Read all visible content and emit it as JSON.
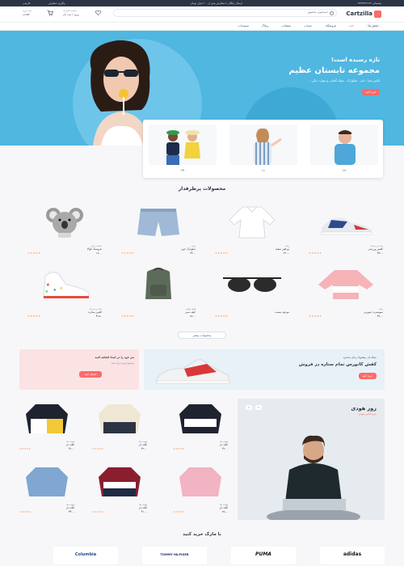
{
  "topbar": {
    "phone": "پشتیبانی ۰۹۳۳۳۴۳۲۱۲۳",
    "shipping": "ارسال رایگان با سفارش بیش از ۲۰۰ هزار تومان",
    "order_tracking": "پیگیری سفارش",
    "lang": "فارسی"
  },
  "header": {
    "logo": "Cartzilla",
    "search_placeholder": "جستجوی محصول",
    "account_line1": "حساب کاربری",
    "account_line2": "ورود / ثبت نام",
    "cart_label": "سبد خرید",
    "cart_total": "۶۵۷ت"
  },
  "nav": {
    "categories": "بخش ها",
    "items": [
      "خانه",
      "فروشگاه",
      "حساب",
      "صفحات",
      "وبلاگ",
      "مستندات"
    ]
  },
  "hero": {
    "eyebrow": "تازه رسیده است!",
    "title": "مجموعه تابستان عظیم",
    "subtitle": "لباس شنا ، تاپ ، شلوارک ، عینک آفتابی و موارد دیگر ...",
    "button": "خرید کنید"
  },
  "categories": [
    {
      "label": "مرد"
    },
    {
      "label": "زن"
    },
    {
      "label": "بچه"
    }
  ],
  "trending": {
    "title": "محصولات پرطرفدار",
    "products": [
      {
        "cat": "زنانه و مردانه",
        "name": "کفش ورزشی",
        "price": "۴۵۰۰",
        "img": "sneaker-blue"
      },
      {
        "cat": "زنانه",
        "name": "پیراهن سفید",
        "price": "۳۲۰۰",
        "img": "blouse"
      },
      {
        "cat": "زنانه",
        "name": "شلوارک جین",
        "price": "۲۴۰۰",
        "img": "shorts"
      },
      {
        "cat": "اسباب بازی",
        "name": "عروسک کوالا",
        "price": "۱۸۰۰",
        "img": "koala"
      },
      {
        "cat": "زنانه",
        "name": "سویشرت صورتی",
        "price": "۴۸۰۰",
        "img": "pink-top"
      },
      {
        "cat": "",
        "name": "موجود نیست",
        "price": "",
        "img": "sunglasses"
      },
      {
        "cat": "کوله پشتی",
        "name": "کیف سبز",
        "price": "۲۵۰۰",
        "img": "backpack"
      },
      {
        "cat": "زنانه و مردانه",
        "name": "کفش ستاره",
        "price": "۴۱۵۰",
        "img": "sneaker-star"
      }
    ],
    "more_button": "محصولات بیشتر"
  },
  "promos": {
    "left_title": "مجله لژ، پیشنهاد زمان محدود",
    "left_heading": "کفش کانورس تمام ستاره در فروش",
    "left_button": "خرید کنید",
    "right_title": "بتر خود را در ابتدا اضافه کنید",
    "right_text": "پیشنهاد ویژه برای شما",
    "right_button": "اضافه کنید"
  },
  "hoodie_day": {
    "title": "روز هودی",
    "subtitle": "خرید لباس هودی",
    "products": [
      {
        "cat": "هودی ها",
        "name": "کلاه دار",
        "price": "۴۲۰۰"
      },
      {
        "cat": "هودی ها",
        "name": "کلاه دار",
        "price": "۴۹۰۰"
      },
      {
        "cat": "هودی ها",
        "name": "کلاه دار",
        "price": "۴۶۰۰"
      },
      {
        "cat": "هودی ها",
        "name": "کلاه دار",
        "price": "۳۸۰۰"
      },
      {
        "cat": "هودی ها",
        "name": "کلاه دار",
        "price": "۴۱۰۰"
      },
      {
        "cat": "هودی ها",
        "name": "کلاه دار",
        "price": "۴۴۰۰"
      }
    ]
  },
  "brands": {
    "title": "با مارک خرید کنید",
    "items": [
      "adidas",
      "PUMA",
      "TOMMY HILFIGER",
      "Columbia"
    ]
  },
  "colors": {
    "accent": "#fe696a",
    "dark": "#2b3445",
    "hero_bg": "#4fb7e0",
    "star": "#fea569"
  }
}
